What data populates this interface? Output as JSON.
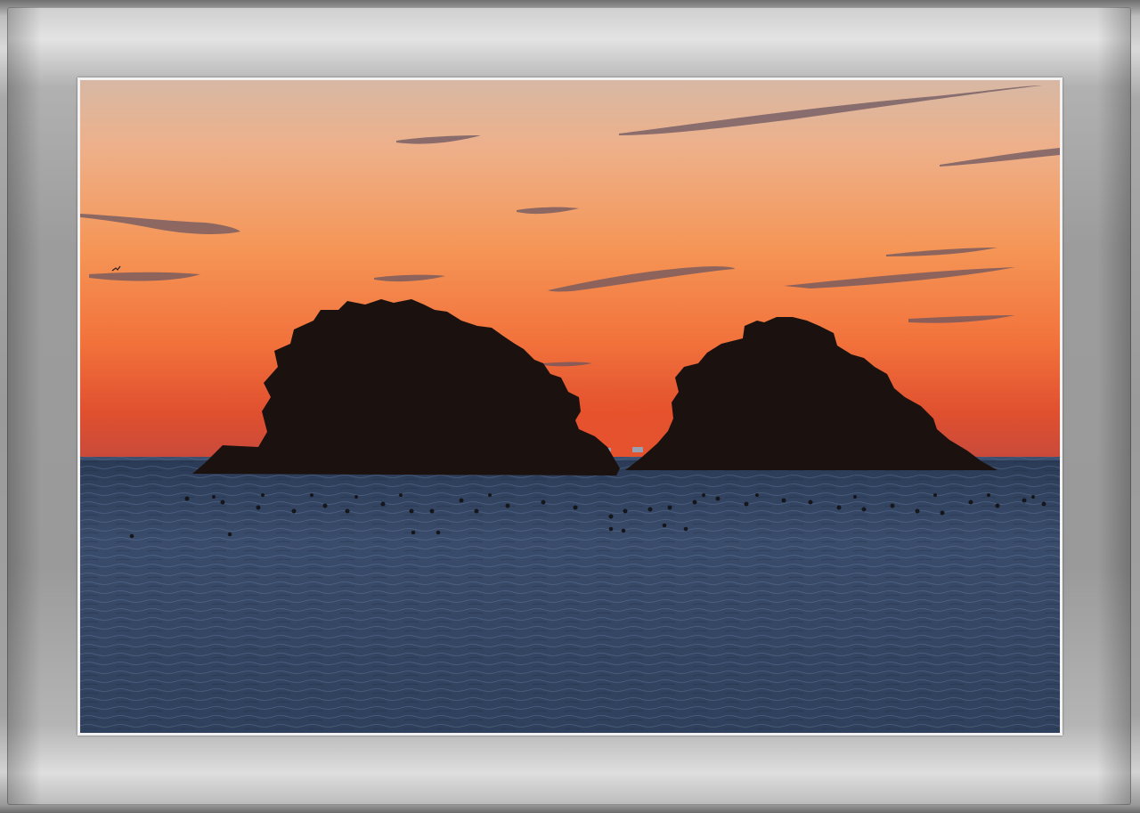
{
  "scene": {
    "colors": {
      "frame": "#9a9a9a",
      "mat": "#f2f2f2",
      "sky_top": "#d9b39a",
      "sky_mid": "#f3964f",
      "sky_horizon": "#e3502d",
      "sea": "#32435e",
      "silhouette": "#1b1210"
    }
  }
}
